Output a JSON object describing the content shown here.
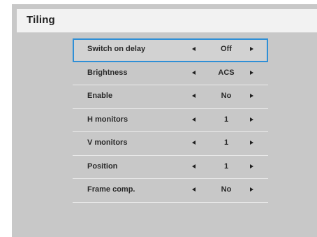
{
  "window": {
    "title": "Tiling"
  },
  "menu": {
    "selected_index": 0,
    "items": [
      {
        "label": "Switch on delay",
        "value": "Off"
      },
      {
        "label": "Brightness",
        "value": "ACS"
      },
      {
        "label": "Enable",
        "value": "No"
      },
      {
        "label": "H monitors",
        "value": "1"
      },
      {
        "label": "V monitors",
        "value": "1"
      },
      {
        "label": "Position",
        "value": "1"
      },
      {
        "label": "Frame comp.",
        "value": "No"
      }
    ]
  },
  "colors": {
    "panel_background": "#c8c8c8",
    "title_bar_background": "#f2f2f2",
    "selection_border": "#2f8fd6",
    "row_separator": "#ebebeb",
    "text": "#2a2a2a"
  },
  "icons": {
    "decrease": "left-arrow-icon",
    "increase": "right-arrow-icon"
  }
}
